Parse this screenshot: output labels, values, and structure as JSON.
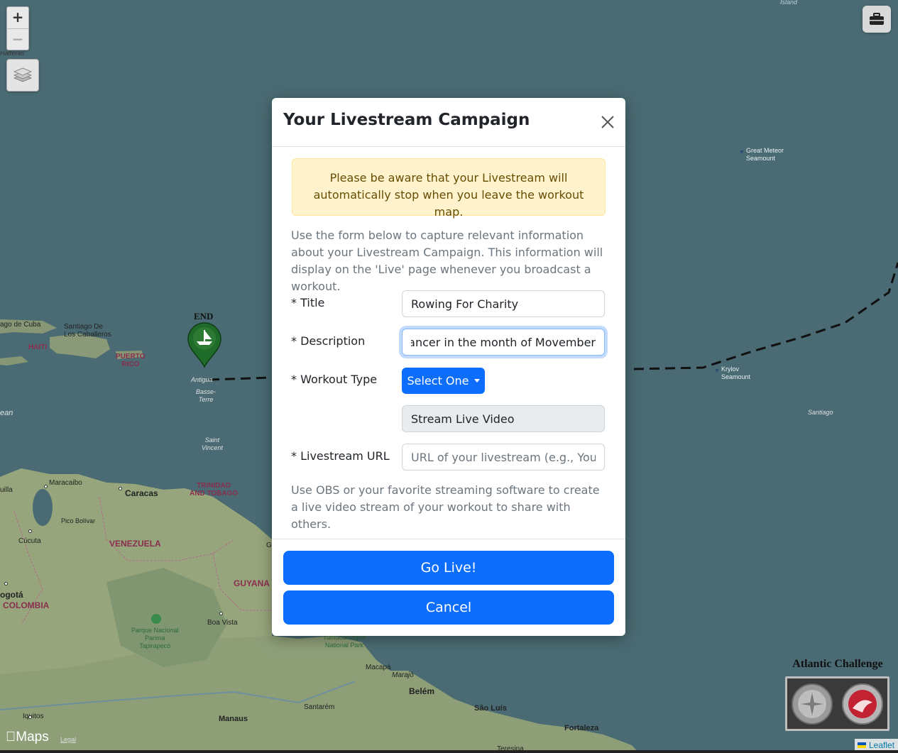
{
  "map": {
    "end_marker_label": "END",
    "labels": {
      "island": "Island",
      "hatteras": "Hatteras",
      "great_meteor": "Great Meteor\nSeamount",
      "santiago_cuba": "ago de Cuba",
      "santiago_caballeros": "Santiago De\nLos Caballeros",
      "haiti": "HAITI",
      "puerto_rico": "PUERTO\nRICO",
      "antigua": "Antigua",
      "basse_terre": "Basse-\nTerre",
      "krylov": "Krylov\nSeamount",
      "santiago_sea": "Santiago",
      "ocean": "ean",
      "saint_vincent": "Saint\nVincent",
      "trinidad": "TRINIDAD\nAND TOBAGO",
      "uilla": "uilla",
      "maracaibo": "Maracaibo",
      "caracas": "Caracas",
      "pico_bolivar": "Pico Bolívar",
      "cucuta": "Cúcuta",
      "venezuela": "VENEZUELA",
      "guyana": "GUYANA",
      "g_label": "G",
      "bogota": "ogotá",
      "colombia": "COLOMBIA",
      "parque_canaima": "Parque Nacional\nParima\nTapirapecó",
      "boa_vista": "Boa Vista",
      "tumucumaque": "Tumucumaque\nNational Park",
      "macapa": "Macapá",
      "marajo": "Marajó",
      "belem": "Belém",
      "santarem": "Santarém",
      "sao_luis": "São Luís",
      "fortaleza": "Fortaleza",
      "iquitos": "Iquitos",
      "manaus": "Manaus",
      "teresina": "Teresina"
    },
    "controls": {
      "zoom_in": "+",
      "zoom_out": "−",
      "layers_icon": "layers-icon",
      "toolbox_icon": "toolbox-icon"
    },
    "challenge_title": "Atlantic Challenge",
    "maps_brand": "Maps",
    "legal": "Legal",
    "attribution": "Leaflet"
  },
  "modal": {
    "title": "Your Livestream Campaign",
    "close_icon": "close-icon",
    "alert": "Please be aware that your Livestream will automatically stop when you leave the workout map.",
    "intro": "Use the form below to capture relevant information about your Livestream Campaign. This information will display on the 'Live' page whenever you broadcast a workout.",
    "fields": {
      "title_label": "* Title",
      "title_value": "Rowing For Charity",
      "description_label": "* Description",
      "description_value": "Raising money for Prostate Cancer in the month of Movember.",
      "workout_type_label": "* Workout Type",
      "workout_type_button": "Select One",
      "stream_type_value": "Stream Live Video",
      "url_label": "* Livestream URL",
      "url_placeholder": "URL of your livestream (e.g., YouTube)"
    },
    "help": "Use OBS or your favorite streaming software to create a live video stream of your workout to share with others.",
    "go_live_label": "Go Live!",
    "cancel_label": "Cancel"
  },
  "colors": {
    "ocean": "#4a6b73",
    "primary": "#0d6efd",
    "alert_bg": "#fff3cd",
    "alert_text": "#664d03"
  }
}
